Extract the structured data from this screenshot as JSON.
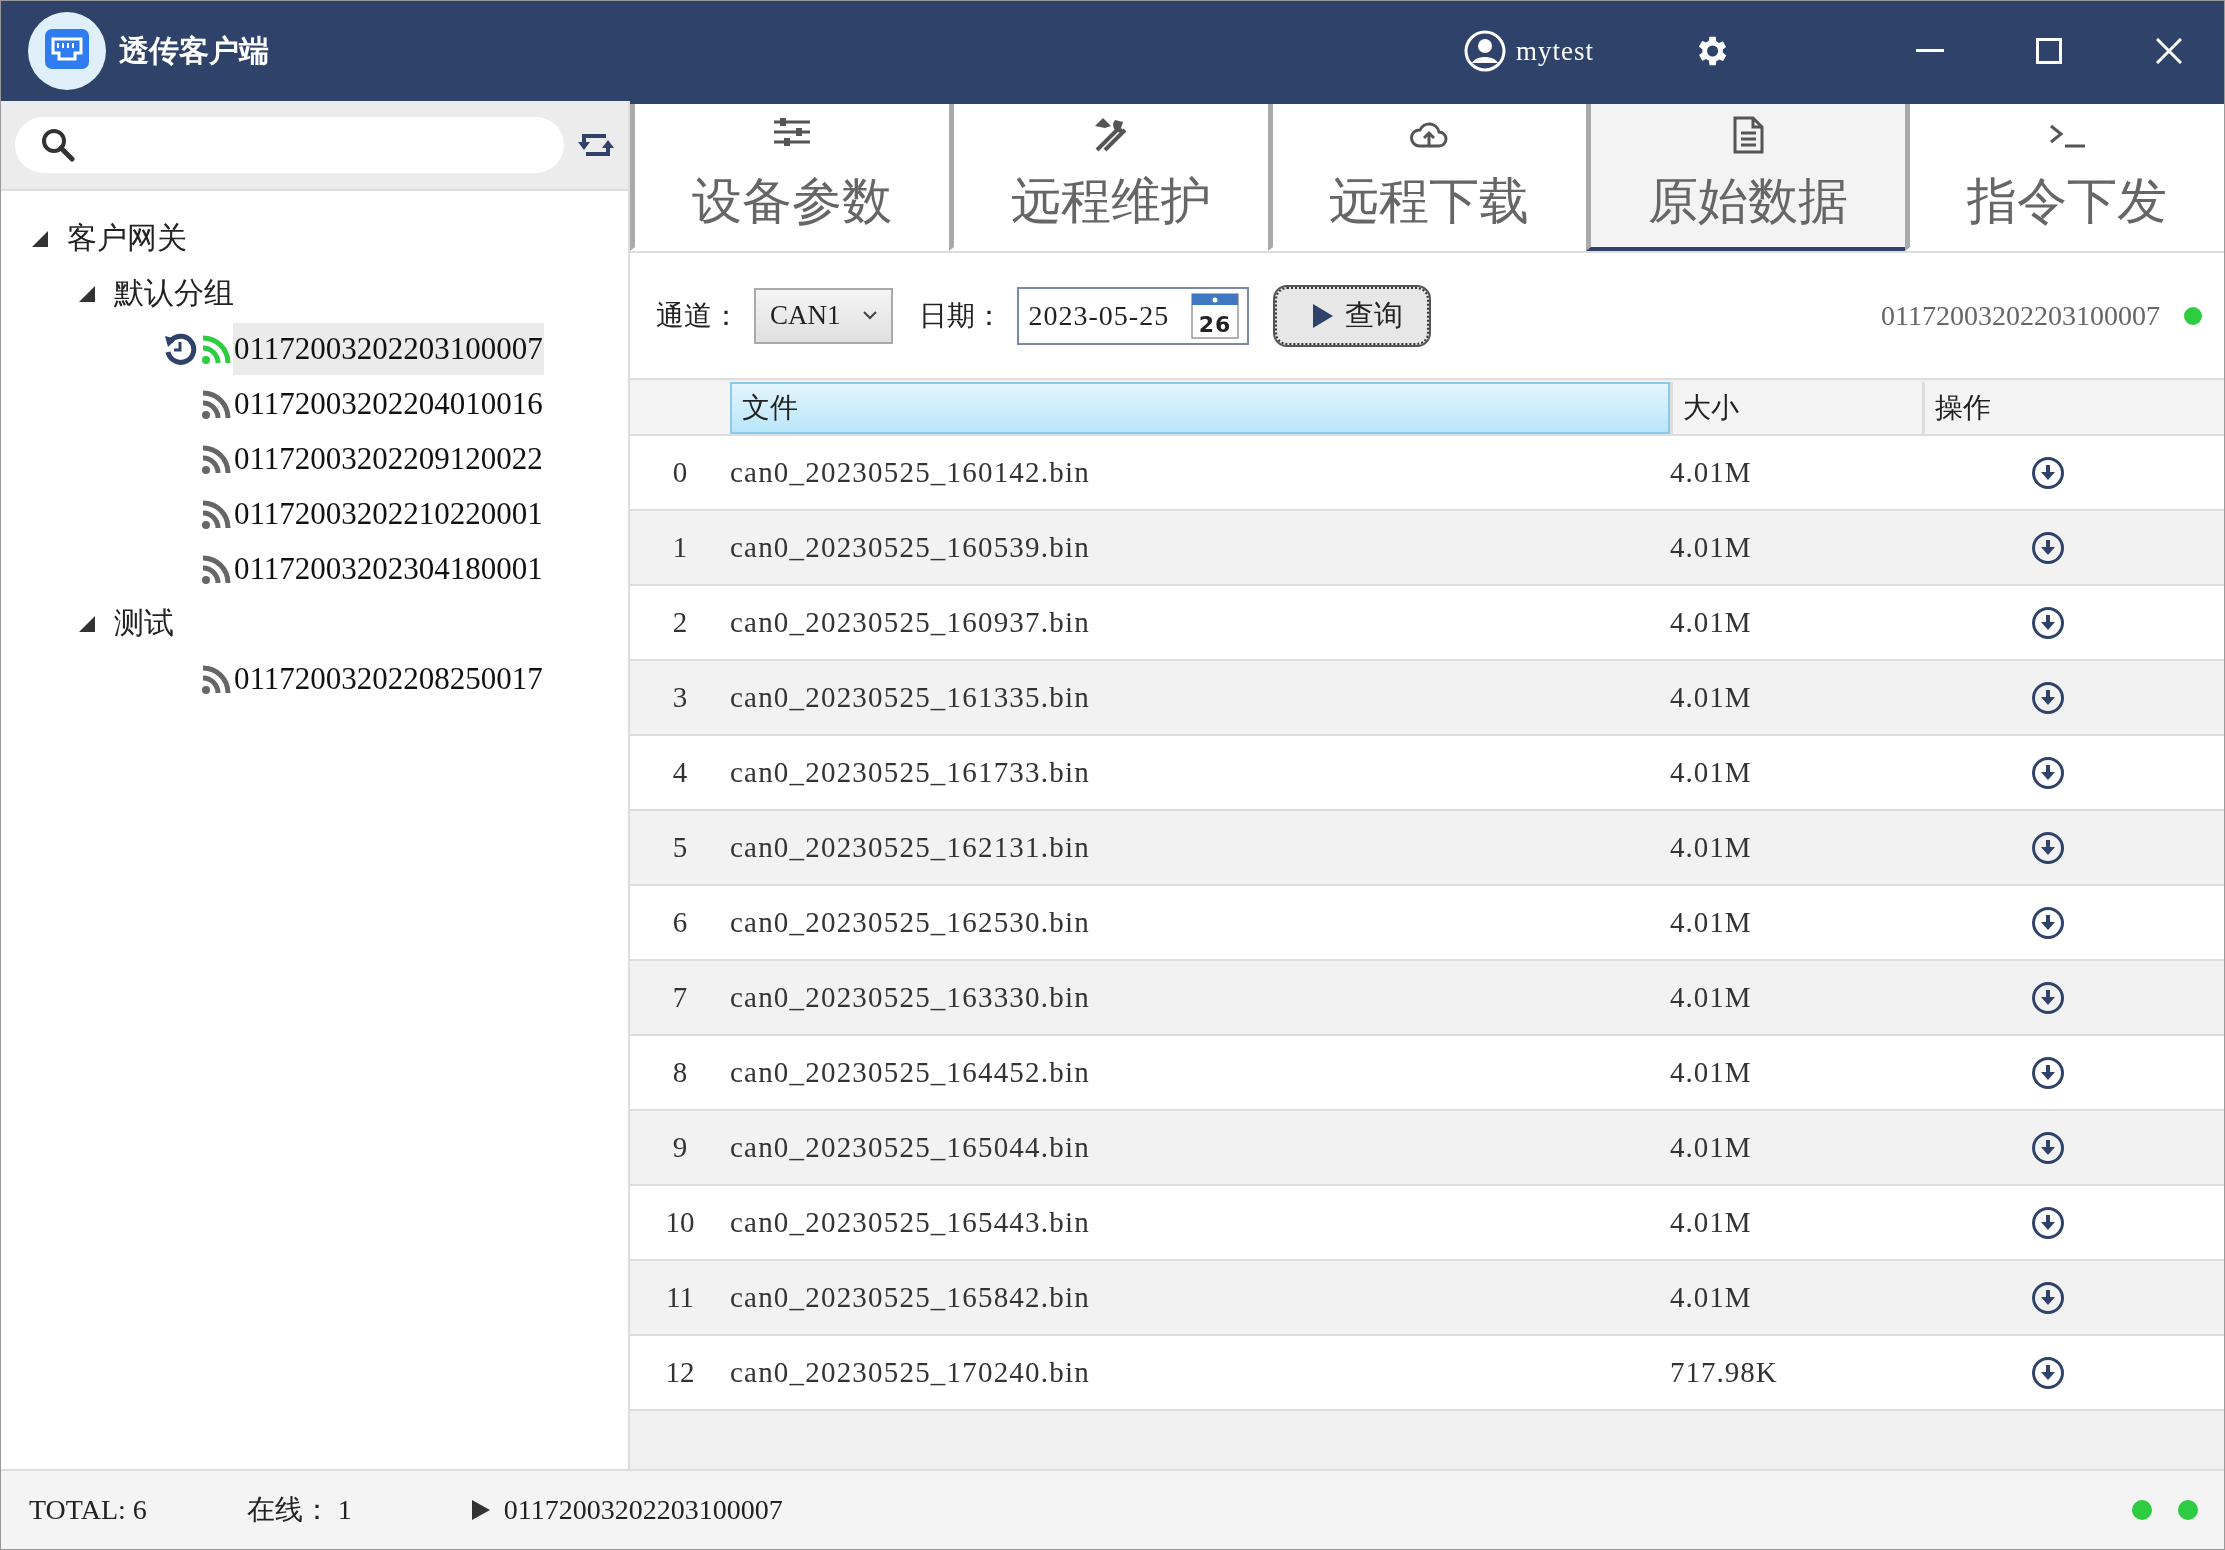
{
  "window": {
    "title": "透传客户端",
    "user": "mytest"
  },
  "sidebar": {
    "tree": [
      {
        "kind": "group",
        "label": "客户网关",
        "expanded": true,
        "children": [
          {
            "kind": "group",
            "label": "默认分组",
            "expanded": true,
            "children": [
              {
                "kind": "device",
                "label": "01172003202203100007",
                "online": true,
                "selected": true,
                "history": true
              },
              {
                "kind": "device",
                "label": "01172003202204010016",
                "online": false,
                "selected": false,
                "history": false
              },
              {
                "kind": "device",
                "label": "01172003202209120022",
                "online": false,
                "selected": false,
                "history": false
              },
              {
                "kind": "device",
                "label": "01172003202210220001",
                "online": false,
                "selected": false,
                "history": false
              },
              {
                "kind": "device",
                "label": "01172003202304180001",
                "online": false,
                "selected": false,
                "history": false
              }
            ]
          },
          {
            "kind": "group",
            "label": "测试",
            "expanded": true,
            "children": [
              {
                "kind": "device",
                "label": "01172003202208250017",
                "online": false,
                "selected": false,
                "history": false
              }
            ]
          }
        ]
      }
    ]
  },
  "tabs": [
    {
      "kind": "sliders",
      "label": "设备参数",
      "selected": false
    },
    {
      "kind": "tools",
      "label": "远程维护",
      "selected": false
    },
    {
      "kind": "cloud",
      "label": "远程下载",
      "selected": false
    },
    {
      "kind": "document",
      "label": "原始数据",
      "selected": true
    },
    {
      "kind": "terminal",
      "label": "指令下发",
      "selected": false
    }
  ],
  "filter": {
    "channel_label": "通道：",
    "channel": "CAN1",
    "date_label": "日期：",
    "date": "2023-05-25",
    "calendar_day": "26",
    "query_button": "查询",
    "device": "01172003202203100007",
    "status_dot": {
      "color": "#2ecc40"
    }
  },
  "table": {
    "columns": [
      {
        "label": "文件",
        "selected": true
      },
      {
        "label": "大小",
        "selected": false
      },
      {
        "label": "操作",
        "selected": false
      }
    ],
    "rows": [
      {
        "index": "0",
        "file": "can0_20230525_160142.bin",
        "size": "4.01M"
      },
      {
        "index": "1",
        "file": "can0_20230525_160539.bin",
        "size": "4.01M"
      },
      {
        "index": "2",
        "file": "can0_20230525_160937.bin",
        "size": "4.01M"
      },
      {
        "index": "3",
        "file": "can0_20230525_161335.bin",
        "size": "4.01M"
      },
      {
        "index": "4",
        "file": "can0_20230525_161733.bin",
        "size": "4.01M"
      },
      {
        "index": "5",
        "file": "can0_20230525_162131.bin",
        "size": "4.01M"
      },
      {
        "index": "6",
        "file": "can0_20230525_162530.bin",
        "size": "4.01M"
      },
      {
        "index": "7",
        "file": "can0_20230525_163330.bin",
        "size": "4.01M"
      },
      {
        "index": "8",
        "file": "can0_20230525_164452.bin",
        "size": "4.01M"
      },
      {
        "index": "9",
        "file": "can0_20230525_165044.bin",
        "size": "4.01M"
      },
      {
        "index": "10",
        "file": "can0_20230525_165443.bin",
        "size": "4.01M"
      },
      {
        "index": "11",
        "file": "can0_20230525_165842.bin",
        "size": "4.01M"
      },
      {
        "index": "12",
        "file": "can0_20230525_170240.bin",
        "size": "717.98K"
      }
    ]
  },
  "status_bar": {
    "total": "TOTAL: 6",
    "online": "在线： 1",
    "current_device": "01172003202203100007",
    "indicators": [
      {
        "color": "#2ecc40"
      },
      {
        "color": "#2ecc40"
      }
    ]
  }
}
